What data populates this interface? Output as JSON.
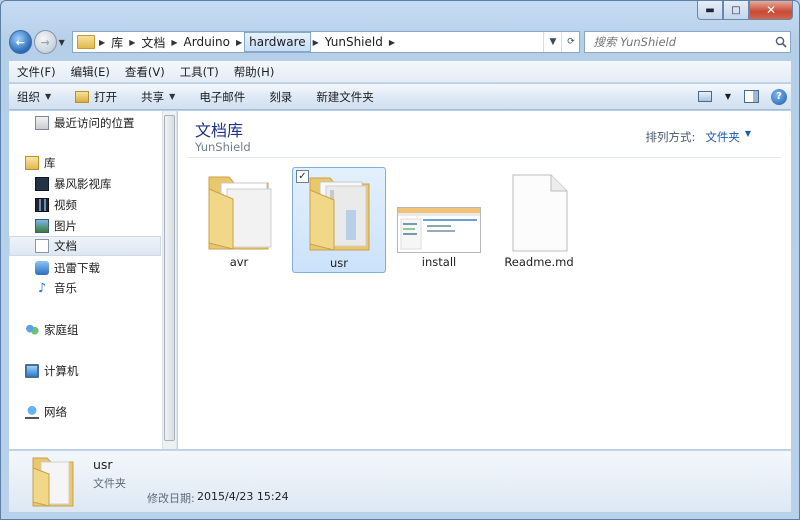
{
  "window": {
    "controls": {
      "minimize": "▬",
      "maximize": "□",
      "close": "✕"
    }
  },
  "nav": {
    "back_icon": "←",
    "forward_icon": "→",
    "history_dropdown": "▼"
  },
  "address": {
    "breadcrumbs": [
      "库",
      "文档",
      "Arduino",
      "hardware",
      "YunShield"
    ],
    "separator": "▶",
    "dropdown_icon": "▼",
    "refresh_icon": "⟳"
  },
  "search": {
    "placeholder": "搜索 YunShield",
    "icon": "magnifier-icon"
  },
  "menu": [
    "文件(F)",
    "编辑(E)",
    "查看(V)",
    "工具(T)",
    "帮助(H)"
  ],
  "commands": {
    "organize": "组织",
    "open": "打开",
    "share": "共享",
    "email": "电子邮件",
    "burn": "刻录",
    "new_folder": "新建文件夹",
    "help": "?"
  },
  "navpane": {
    "items": [
      {
        "label": "最近访问的位置",
        "icon": "recent-places-icon"
      },
      {
        "label": "库",
        "icon": "library-icon"
      },
      {
        "label": "暴风影视库",
        "icon": "video-library-icon"
      },
      {
        "label": "视频",
        "icon": "videos-icon"
      },
      {
        "label": "图片",
        "icon": "pictures-icon"
      },
      {
        "label": "文档",
        "icon": "documents-icon"
      },
      {
        "label": "迅雷下载",
        "icon": "xunlei-download-icon"
      },
      {
        "label": "音乐",
        "icon": "music-icon"
      },
      {
        "label": "家庭组",
        "icon": "homegroup-icon"
      },
      {
        "label": "计算机",
        "icon": "computer-icon"
      },
      {
        "label": "网络",
        "icon": "network-icon"
      }
    ]
  },
  "content": {
    "title": "文档库",
    "subtitle": "YunShield",
    "arrange_label": "排列方式:",
    "arrange_value": "文件夹",
    "files": [
      {
        "name": "avr",
        "type": "folder"
      },
      {
        "name": "usr",
        "type": "folder",
        "selected": true
      },
      {
        "name": "install",
        "type": "image"
      },
      {
        "name": "Readme.md",
        "type": "file"
      }
    ]
  },
  "details": {
    "name": "usr",
    "type": "文件夹",
    "modified_label": "修改日期:",
    "modified_value": "2015/4/23 15:24"
  },
  "colors": {
    "accent": "#1e3287",
    "link": "#1c5ab4",
    "selection": "#cbe2fb"
  }
}
